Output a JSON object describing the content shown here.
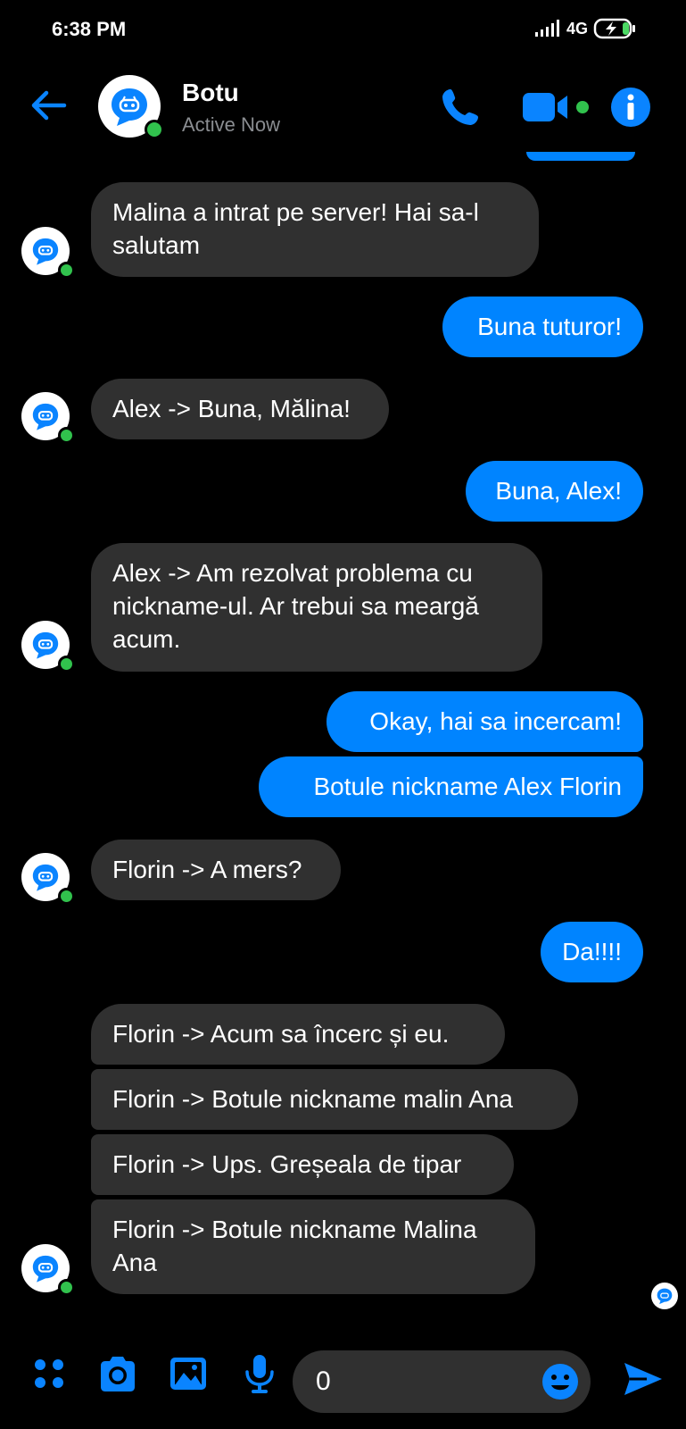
{
  "status_bar": {
    "time": "6:38 PM",
    "network": "4G",
    "icons": [
      "signal-icon",
      "battery-charging-icon"
    ]
  },
  "header": {
    "contact_name": "Botu",
    "contact_status": "Active Now",
    "icons": [
      "back-arrow-icon",
      "phone-icon",
      "video-camera-icon",
      "info-icon"
    ]
  },
  "messages": [
    {
      "from": "bot",
      "text": "Malina a intrat pe server! Hai sa-l salutam"
    },
    {
      "from": "me",
      "text": "Buna tuturor!"
    },
    {
      "from": "bot",
      "text": "Alex -> Buna, Mălina!"
    },
    {
      "from": "me",
      "text": "Buna, Alex!"
    },
    {
      "from": "bot",
      "text": "Alex -> Am rezolvat problema cu nickname-ul. Ar trebui sa meargă acum."
    },
    {
      "from": "me",
      "text": "Okay, hai sa incercam!"
    },
    {
      "from": "me",
      "text": "Botule nickname Alex Florin"
    },
    {
      "from": "bot",
      "text": "Florin -> A mers?"
    },
    {
      "from": "me",
      "text": "Da!!!!"
    },
    {
      "from": "bot",
      "text": "Florin -> Acum sa încerc și eu."
    },
    {
      "from": "bot",
      "text": "Florin -> Botule nickname malin Ana"
    },
    {
      "from": "bot",
      "text": "Florin -> Ups. Greșeala de tipar"
    },
    {
      "from": "bot",
      "text": "Florin -> Botule nickname Malina Ana"
    }
  ],
  "composer": {
    "input_value": "0",
    "icons": [
      "apps-grid-icon",
      "camera-icon",
      "gallery-icon",
      "microphone-icon",
      "emoji-icon",
      "send-icon"
    ]
  },
  "colors": {
    "accent": "#0084ff",
    "incoming_bubble": "#303030",
    "background": "#000000",
    "presence": "#31c24d",
    "secondary_text": "#8a8d91"
  }
}
